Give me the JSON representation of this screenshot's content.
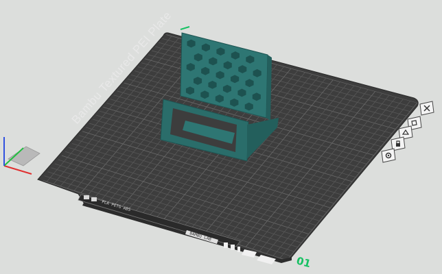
{
  "plate": {
    "label": "Bambu Textured PEI Plate",
    "number": "01",
    "name_strip_text": "PLA PETG ABS",
    "bottom_strip_text": "BAMBU LAB"
  },
  "colors": {
    "background": "#dcdedc",
    "bed": "#3d3d3d",
    "grid": "#555555",
    "model": "#2e7673",
    "accent_green": "#17c163"
  },
  "toolbar": {
    "buttons": [
      {
        "name": "delete-plate",
        "icon": "close-icon"
      },
      {
        "name": "arrange-plate",
        "icon": "arrange-icon"
      },
      {
        "name": "orient-plate",
        "icon": "orient-icon"
      },
      {
        "name": "lock-plate",
        "icon": "lock-icon"
      },
      {
        "name": "plate-settings",
        "icon": "gear-icon"
      }
    ]
  },
  "axes": {
    "x_color": "#e03030",
    "y_color": "#22c040",
    "z_color": "#3050e0"
  }
}
